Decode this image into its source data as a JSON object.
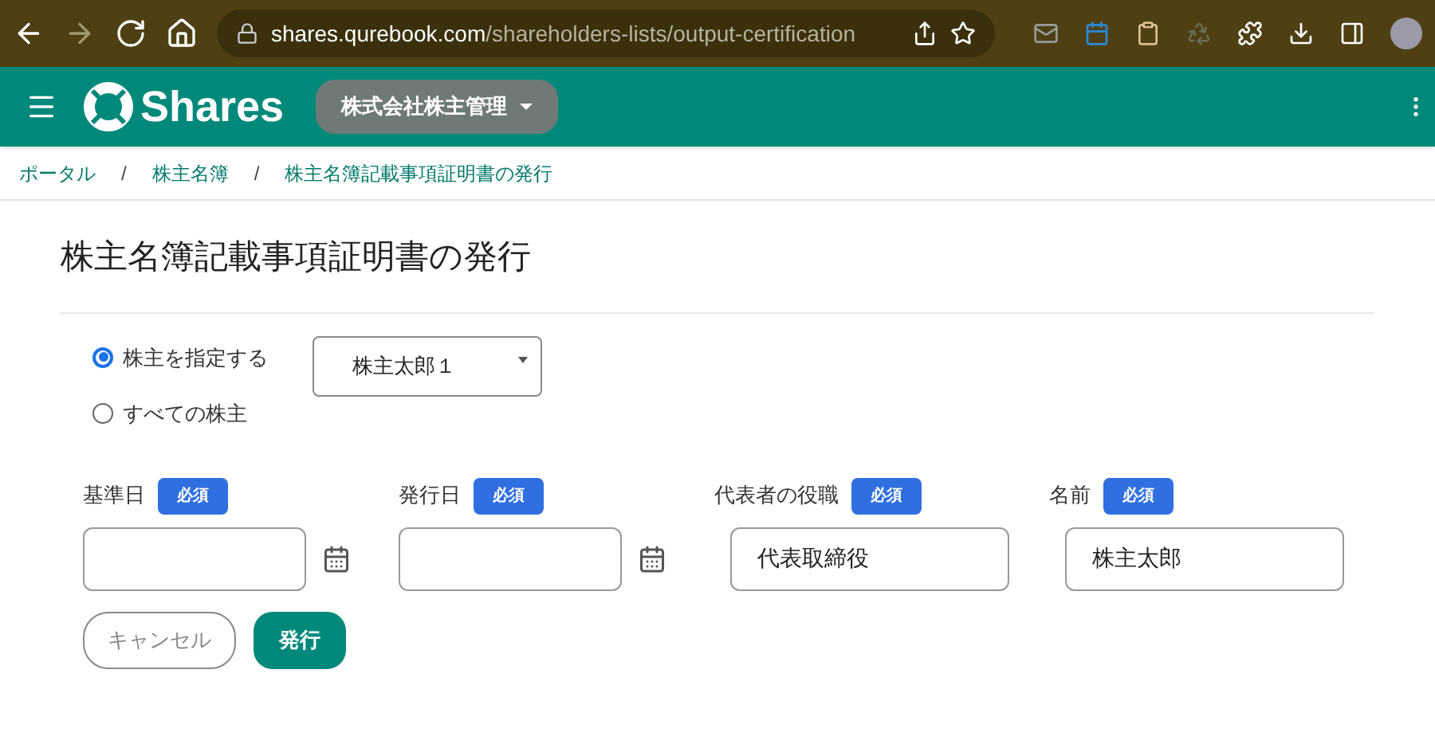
{
  "browser": {
    "url_host": "shares.qurebook.com",
    "url_path": "/shareholders-lists/output-certification"
  },
  "app_bar": {
    "logo": "Shares",
    "company": "株式会社株主管理"
  },
  "breadcrumb": {
    "separator": "/",
    "items": [
      "ポータル",
      "株主名簿",
      "株主名簿記載事項証明書の発行"
    ]
  },
  "title": "株主名簿記載事項証明書の発行",
  "scope": [
    {
      "label": "株主を指定する",
      "selected": true
    },
    {
      "label": "すべての株主",
      "selected": false
    }
  ],
  "shareholder_select": {
    "value": "株主太郎１"
  },
  "fields": [
    {
      "kind": "date",
      "label": "基準日",
      "badge": "必須"
    },
    {
      "kind": "date",
      "label": "発行日",
      "badge": "必須"
    },
    {
      "kind": "text",
      "label": "代表者の役職",
      "badge": "必須",
      "value": "代表取締役"
    },
    {
      "kind": "text",
      "label": "名前",
      "badge": "必須",
      "value": "株主太郎"
    }
  ],
  "buttons": [
    {
      "kind": "outline",
      "label": "キャンセル"
    },
    {
      "kind": "primary",
      "label": "発行"
    }
  ]
}
